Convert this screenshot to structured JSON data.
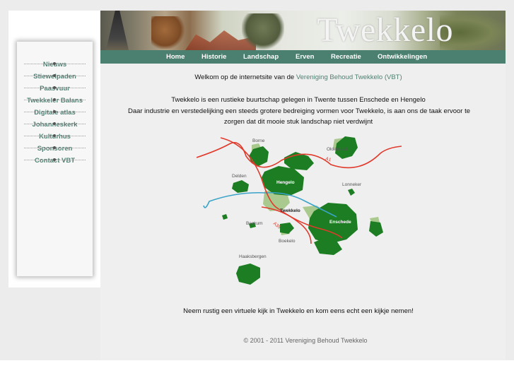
{
  "header": {
    "title": "Twekkelo"
  },
  "nav": [
    {
      "label": "Home"
    },
    {
      "label": "Historie"
    },
    {
      "label": "Landschap"
    },
    {
      "label": "Erven"
    },
    {
      "label": "Recreatie"
    },
    {
      "label": "Ontwikkelingen"
    }
  ],
  "sidebar": {
    "items": [
      {
        "label": "Nieuws"
      },
      {
        "label": "Stiewelpaden"
      },
      {
        "label": "Paasvuur"
      },
      {
        "label": "Twekkeler Balans"
      },
      {
        "label": "Digitale atlas"
      },
      {
        "label": "Johanneskerk"
      },
      {
        "label": "Kulturhus"
      },
      {
        "label": "Sponsoren"
      },
      {
        "label": "Contact VBT"
      }
    ]
  },
  "content": {
    "welcome_prefix": "Welkom op de internetsite van de ",
    "welcome_link": "Vereniging Behoud Twekkelo (VBT)",
    "intro_line1": "Twekkelo is een rustieke buurtschap gelegen in Twente tussen Enschede en Hengelo",
    "intro_line2": "Daar industrie en verstedelijking een steeds grotere bedreiging vormen voor Twekkelo, is aan ons de taak ervoor te",
    "intro_line3": "zorgen dat dit mooie stuk landschap niet verdwijnt",
    "invite": "Neem rustig een virtuele kijk in Twekkelo en kom eens echt een kijkje nemen!"
  },
  "map": {
    "labels": {
      "borne": "Borne",
      "oldenzaal": "Oldenzaal",
      "a1": "A1",
      "delden": "Delden",
      "hengelo": "Hengelo",
      "lonneker": "Lonneker",
      "twekkelo": "Twekkelo",
      "a35": "A35",
      "beckum": "Beckum",
      "enschede": "Enschede",
      "boekelo": "Boekelo",
      "haaksbergen": "Haaksbergen"
    },
    "colors": {
      "town": "#1c7d22",
      "suburb": "#a9c98e",
      "road": "#e03a2c",
      "canal": "#3aa3c8",
      "label": "#555555",
      "town_label": "#ffffff"
    }
  },
  "footer": {
    "copyright": "© 2001 - 2011 Vereniging Behoud Twekkelo"
  },
  "colors": {
    "accent": "#4b7f6f",
    "link": "#4f7f72",
    "background": "#ececec"
  }
}
